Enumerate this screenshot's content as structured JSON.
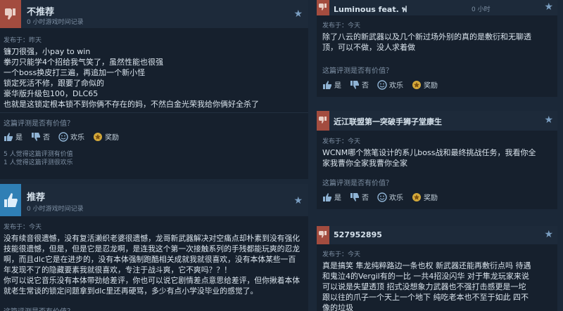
{
  "colors": {
    "negative": "#a34c3f",
    "positive": "#2f7fb5",
    "background": "#1b2838"
  },
  "labels": {
    "question": "这篇评测是否有价值？",
    "yes": "是",
    "no": "否",
    "funny": "欢乐",
    "award": "奖励"
  },
  "reviews": [
    {
      "recommendation": "不推荐",
      "hours": "0 小时游戏时间记录",
      "posted": "发布于：昨天",
      "body": "镰刀很强，小pay to win\n拳刃只能学4个招给我气笑了，虽然性能也很强\n一个boss换皮打三遍，再追加一个新小怪\n锁定死活不修，跟要了命似的\n豪华版升级包100，DLC65\n也就是这锁定根本锁不到你俩不存在的妈，不然白金光荣我给你俩好全杀了",
      "helpful": "5 人觉得这篇评测有价值\n1 人觉得这篇评测很欢乐"
    },
    {
      "recommendation": "推荐",
      "hours": "0 小时游戏时间记录",
      "posted": "发布于：今天",
      "body": "没有续音很遗憾，没有复活濑织老婆很遗憾，龙哥新武器解决对空痛点却朴素到没有强化技能很遗憾，但是，但是它是忍龙啊，是连我这个第一次接触系列的手残都能玩爽的忍龙啊，而且dlc它是在进步的，没有本体强制跑酷相关成就我就很喜欢，没有本体某些一百年发现不了的隐藏要素我就很喜欢，专注于战斗爽，它不爽吗？？！\n你可以说它音乐没有本体带劲给差评，你也可以说它剧情差点意思给差评，但你揪着本体就老生常谈的锁定问题拿到dlc里还再硬骂，多少有点小学没毕业的感觉了。"
    },
    {
      "name": "Luminous feat. ฟ",
      "hours": "0 小时",
      "posted": "发布于：今天",
      "body": "除了八云的新武器以及几个新过场外别的真的是敷衍和无聊透顶，可以不做，没人求着做"
    },
    {
      "name": "近江联盟第一突破手狮子堂康生",
      "hours": "0 小时",
      "posted": "发布于：今天",
      "body": "WCNM哪个煞笔设计的系儿boss战和最终挑战任务，我看你全家我曹你全家我曹你全家"
    },
    {
      "name": "527952895",
      "hours": "0 小时",
      "posted": "发布于：今天",
      "body": "真是搞笑 隼龙纯粹路边一条也权 新武器还能再敷衍点吗 待遇和鬼泣4的Vergil有的一比 一共4招没闪华 对于隼龙玩家来说可以说是失望透顶 招式没想象力武器也不强打击感更是一坨 跟以往的爪子一个天上一个地下 纯吃老本也不至于如此 四不像的垃圾"
    }
  ]
}
